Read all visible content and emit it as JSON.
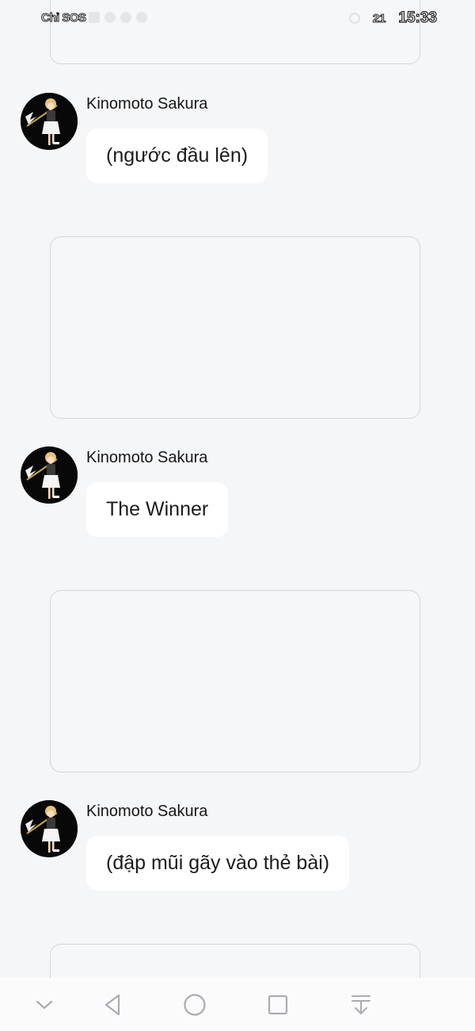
{
  "status_bar": {
    "carrier": "Chỉ SOS",
    "battery": "21",
    "time": "15:33"
  },
  "messages": [
    {
      "sender": "Kinomoto Sakura",
      "text": "(ngước đầu lên)"
    },
    {
      "sender": "Kinomoto Sakura",
      "text": "The Winner"
    },
    {
      "sender": "Kinomoto Sakura",
      "text": "(đập mũi gãy vào thẻ bài)"
    }
  ],
  "icons": {
    "collapse": "chevron-down-icon",
    "back": "back-triangle-icon",
    "home": "home-circle-icon",
    "recents": "recents-square-icon",
    "pull_down": "pull-down-icon",
    "avatar": "avatar-image"
  },
  "colors": {
    "background": "#f5f6f8",
    "bubble": "#ffffff",
    "card_border": "#d3d5d9",
    "nav_icon": "#a9acb2"
  }
}
